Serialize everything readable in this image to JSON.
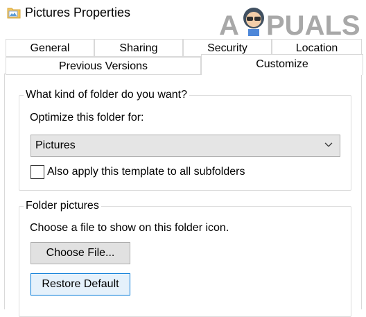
{
  "window": {
    "title": "Pictures Properties"
  },
  "watermark": {
    "text": "A  PUALS"
  },
  "tabs": {
    "row1": [
      "General",
      "Sharing",
      "Security",
      "Location"
    ],
    "row2": [
      "Previous Versions",
      "Customize"
    ],
    "active": "Customize"
  },
  "folder_type": {
    "group_title": "What kind of folder do you want?",
    "optimize_label": "Optimize this folder for:",
    "selected_option": "Pictures",
    "subfolders_checkbox": {
      "label": "Also apply this template to all subfolders",
      "checked": false
    }
  },
  "folder_pictures": {
    "group_title": "Folder pictures",
    "description": "Choose a file to show on this folder icon.",
    "choose_button": "Choose File...",
    "restore_button": "Restore Default"
  },
  "colors": {
    "accent": "#0078d7",
    "button_bg": "#e1e1e1",
    "select_bg": "#e5e5e5",
    "border": "#d9d9d9"
  }
}
